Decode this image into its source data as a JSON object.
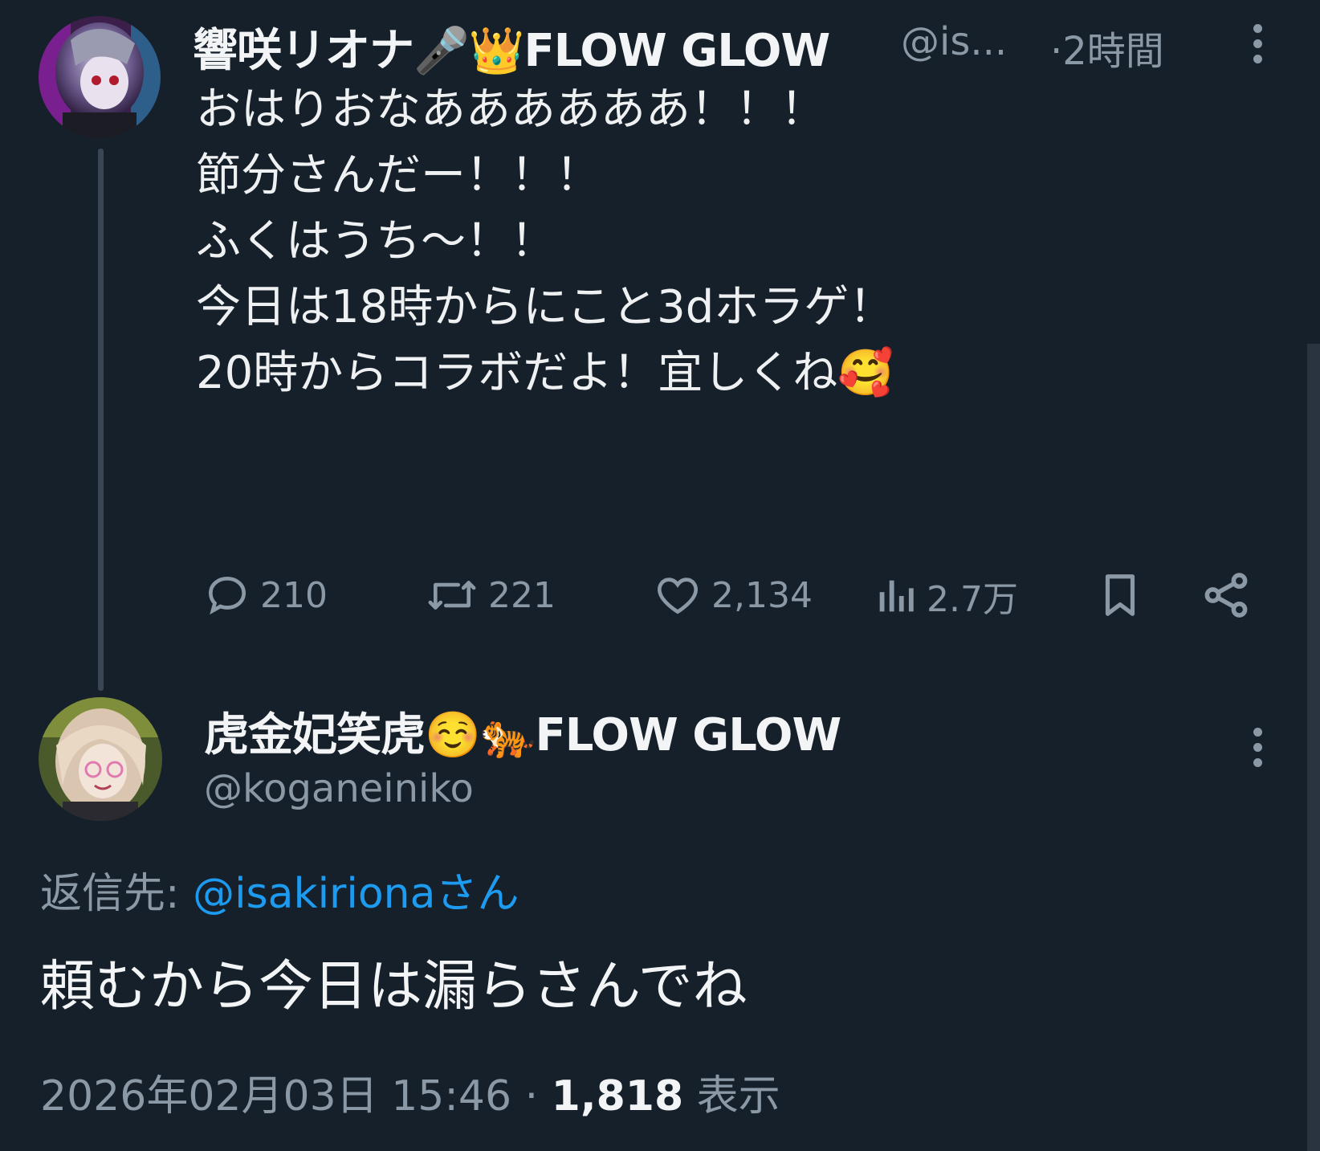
{
  "tweet": {
    "author_name": "響咲リオナ🎤👑FLOW GLOW",
    "author_handle": "@is...",
    "time": "·2時間",
    "lines": [
      "おはりおなああああああ！！！",
      "節分さんだー！！！",
      "",
      "ふくはうち〜！！",
      "",
      "今日は18時からにこと3dホラゲ！",
      "20時からコラボだよ！宜しくね🥰"
    ],
    "replies": "210",
    "retweets": "221",
    "likes": "2,134",
    "views": "2.7万"
  },
  "reply": {
    "author_name": "虎金妃笑虎☺️🐅FLOW GLOW",
    "author_handle": "@koganeiniko",
    "reply_to_label": "返信先: ",
    "reply_to_handle": "@isakirionaさん",
    "text": "頼むから今日は漏らさんでね",
    "date": "2026年02月03日 15:46",
    "separator": " · ",
    "view_count": "1,818",
    "view_label": " 表示"
  },
  "colors": {
    "background": "#16202a",
    "text": "#e7e9ea",
    "muted": "#8b98a5",
    "link": "#1d9bf0"
  },
  "icons": [
    "reply-icon",
    "retweet-icon",
    "like-icon",
    "views-icon",
    "bookmark-icon",
    "share-icon",
    "more-icon"
  ]
}
